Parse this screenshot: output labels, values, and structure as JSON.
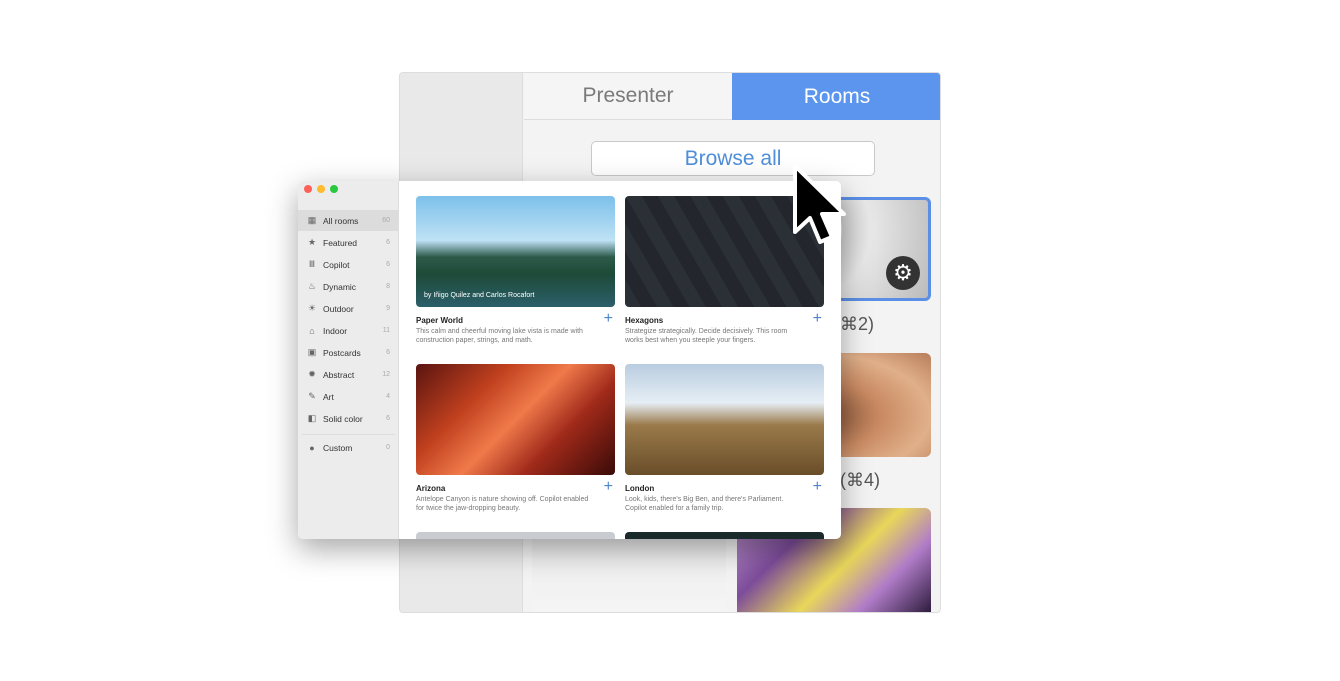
{
  "back_window": {
    "tabs": [
      {
        "label": "Presenter",
        "active": false
      },
      {
        "label": "Rooms",
        "active": true
      }
    ],
    "browse_label": "Browse all",
    "tiles": [
      {
        "label_partial": "s (⌘2)",
        "selected": true,
        "icon": "gear-icon"
      },
      {
        "label_partial": "(⌘4)",
        "selected": false
      }
    ],
    "accent": "#5b95ee"
  },
  "browser": {
    "sidebar": [
      {
        "label": "All rooms",
        "count": "60",
        "icon": "grid-icon",
        "selected": true
      },
      {
        "label": "Featured",
        "count": "6",
        "icon": "star-icon"
      },
      {
        "label": "Copilot",
        "count": "6",
        "icon": "copilot-icon"
      },
      {
        "label": "Dynamic",
        "count": "8",
        "icon": "flame-icon"
      },
      {
        "label": "Outdoor",
        "count": "9",
        "icon": "sun-icon"
      },
      {
        "label": "Indoor",
        "count": "11",
        "icon": "house-icon"
      },
      {
        "label": "Postcards",
        "count": "6",
        "icon": "postcard-icon"
      },
      {
        "label": "Abstract",
        "count": "12",
        "icon": "burst-icon"
      },
      {
        "label": "Art",
        "count": "4",
        "icon": "brush-icon"
      },
      {
        "label": "Solid color",
        "count": "6",
        "icon": "swatch-icon"
      },
      {
        "label": "Custom",
        "count": "0",
        "icon": "person-icon"
      }
    ],
    "rooms": [
      {
        "title": "Paper World",
        "desc": "This calm and cheerful moving lake vista is made with construction paper, strings, and math.",
        "credit": "by Iñigo Quilez and Carlos Rocafort"
      },
      {
        "title": "Hexagons",
        "desc": "Strategize strategically. Decide decisively. This room works best when you steeple your fingers."
      },
      {
        "title": "Arizona",
        "desc": "Antelope Canyon is nature showing off. Copilot enabled for twice the jaw-dropping beauty."
      },
      {
        "title": "London",
        "desc": "Look, kids, there's Big Ben, and there's Parliament. Copilot enabled for a family trip."
      }
    ],
    "add_label": "+"
  }
}
